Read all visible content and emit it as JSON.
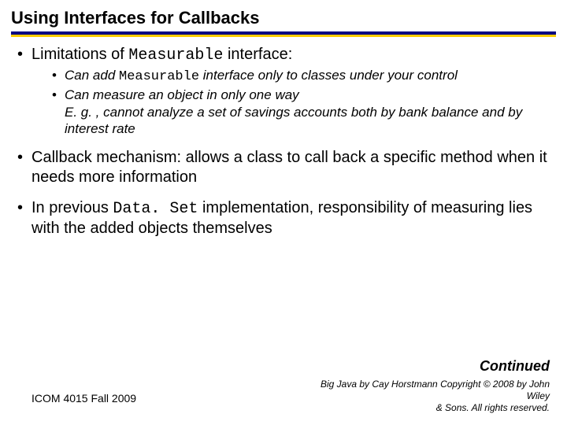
{
  "title": "Using Interfaces for Callbacks",
  "bullets": {
    "b1_pre": "Limitations of ",
    "b1_code": "Measurable",
    "b1_post": " interface:",
    "b1_sub1_pre": "Can add ",
    "b1_sub1_code": "Measurable",
    "b1_sub1_post": " interface only to classes under your control",
    "b1_sub2": "Can measure an object in only one way",
    "b1_sub2_eg": "E. g. , cannot analyze a set of savings accounts both by bank balance and by interest rate",
    "b2": "Callback mechanism: allows a class to call back a specific method when it needs more information",
    "b3_pre": "In previous ",
    "b3_code": "Data. Set",
    "b3_post": " implementation, responsibility of measuring lies with the added objects themselves"
  },
  "continued": "Continued",
  "footer": {
    "left": "ICOM 4015 Fall 2009",
    "right_line1": "Big Java by Cay Horstmann Copyright © 2008 by John Wiley",
    "right_line2": "& Sons.  All rights reserved."
  }
}
